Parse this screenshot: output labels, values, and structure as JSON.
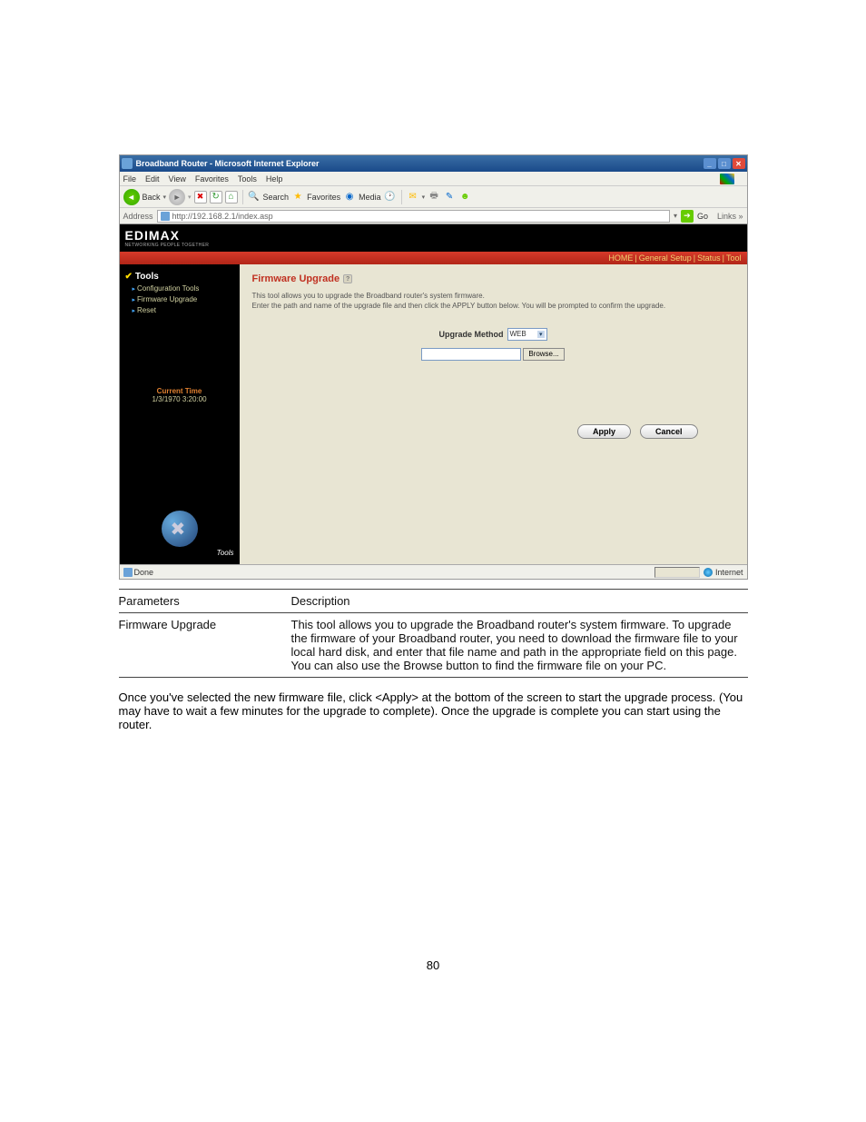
{
  "window": {
    "title": "Broadband Router - Microsoft Internet Explorer"
  },
  "menu": {
    "file": "File",
    "edit": "Edit",
    "view": "View",
    "favorites": "Favorites",
    "tools": "Tools",
    "help": "Help"
  },
  "toolbar": {
    "back": "Back",
    "search": "Search",
    "favorites": "Favorites",
    "media": "Media"
  },
  "address": {
    "label": "Address",
    "value": "http://192.168.2.1/index.asp",
    "go": "Go",
    "links": "Links »"
  },
  "logo": {
    "brand": "EDIMAX",
    "tag": "NETWORKING PEOPLE TOGETHER"
  },
  "topnav": {
    "home": "HOME",
    "general": "General Setup",
    "status": "Status",
    "tool": "Tool",
    "sep": " | "
  },
  "sidebar": {
    "title": "Tools",
    "items": [
      {
        "label": "Configuration Tools"
      },
      {
        "label": "Firmware Upgrade"
      },
      {
        "label": "Reset"
      }
    ],
    "current_time_label": "Current Time",
    "current_time_value": "1/3/1970 3:20:00",
    "footer_label": "Tools"
  },
  "panel": {
    "heading": "Firmware Upgrade",
    "desc": "This tool allows you to upgrade the Broadband router's system firmware.\nEnter the path and name of the upgrade file and then click the APPLY button below. You will be prompted to confirm the upgrade.",
    "upgrade_method_label": "Upgrade Method",
    "upgrade_method_value": "WEB",
    "browse_label": "Browse...",
    "apply_label": "Apply",
    "cancel_label": "Cancel"
  },
  "status": {
    "done": "Done",
    "internet": "Internet"
  },
  "doc_table": {
    "rows": [
      {
        "param": "Parameters",
        "desc": "Description"
      },
      {
        "param": "Firmware Upgrade",
        "desc": "This tool allows you to upgrade the Broadband router's system firmware. To upgrade the firmware of your Broadband router, you need to download the firmware file to your local hard disk, and enter that file name and path in the appropriate field on this page. You can also use the Browse button to find the firmware file on your PC."
      }
    ],
    "apply_text": "Once you've selected the new firmware file, click <Apply> at the bottom of the screen to start the upgrade process. (You may have to wait a few minutes for the upgrade to complete). Once the upgrade is complete you can start using the router."
  },
  "page_number": "80"
}
